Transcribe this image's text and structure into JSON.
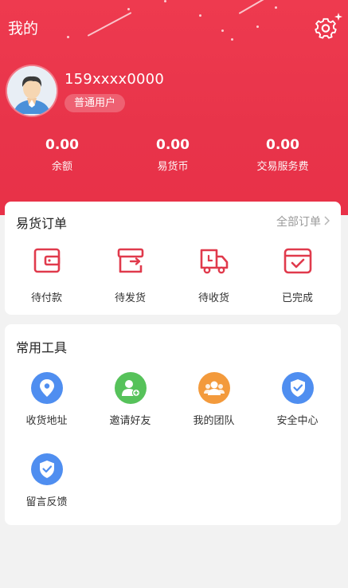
{
  "header": {
    "title": "我的",
    "phone": "159xxxx0000",
    "level": "普通用户",
    "stats": [
      {
        "value": "0.00",
        "label": "余额"
      },
      {
        "value": "0.00",
        "label": "易货币"
      },
      {
        "value": "0.00",
        "label": "交易服务费"
      }
    ]
  },
  "orders": {
    "title": "易货订单",
    "all_label": "全部订单",
    "items": [
      {
        "label": "待付款",
        "icon": "wallet-icon"
      },
      {
        "label": "待发货",
        "icon": "box-send-icon"
      },
      {
        "label": "待收货",
        "icon": "truck-icon"
      },
      {
        "label": "已完成",
        "icon": "completed-box-icon"
      }
    ]
  },
  "tools": {
    "title": "常用工具",
    "items": [
      {
        "label": "收货地址",
        "icon": "location-pin-icon"
      },
      {
        "label": "邀请好友",
        "icon": "invite-user-icon"
      },
      {
        "label": "我的团队",
        "icon": "team-icon"
      },
      {
        "label": "安全中心",
        "icon": "shield-check-icon"
      },
      {
        "label": "留言反馈",
        "icon": "feedback-shield-icon"
      }
    ]
  },
  "colors": {
    "brand_red": "#e8344a",
    "icon_blue": "#4f8ef0",
    "icon_green": "#56c25a",
    "icon_orange": "#f39a3c"
  }
}
